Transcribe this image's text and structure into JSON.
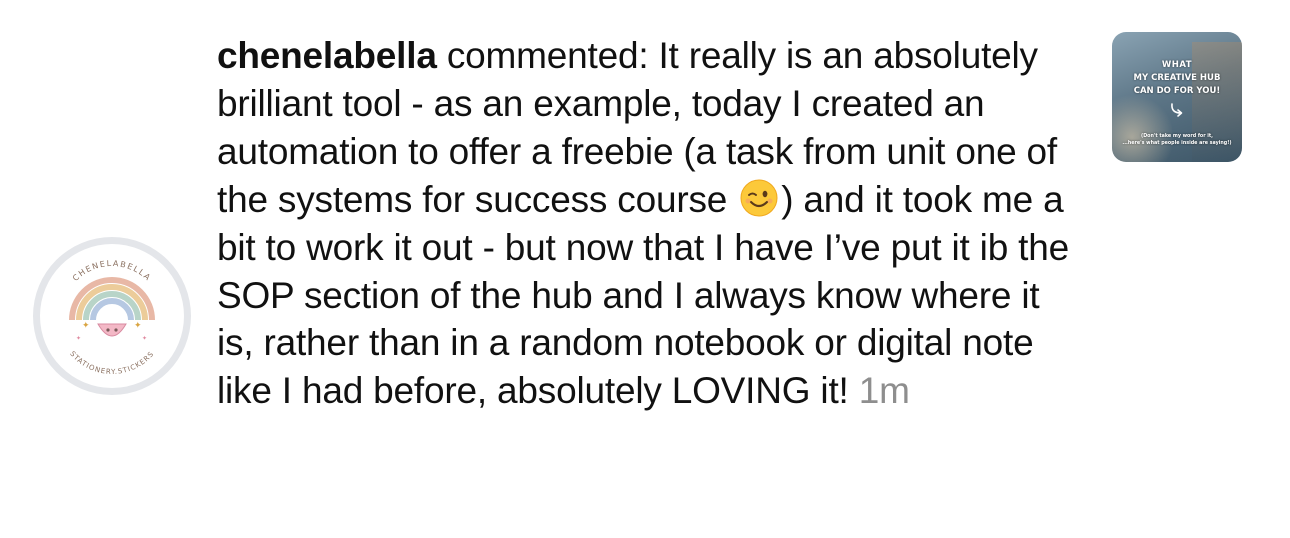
{
  "comment": {
    "username": "chenelabella",
    "text": "commented: It really is an absolutely brilliant tool - as an example, today I created an automation to offer a freebie (a task from unit one of the systems for success course",
    "emoji_icon": "winking-face-icon",
    "text_after_emoji": ") and it took me a bit to work it out - but now that I have I’ve put it ib the SOP section of the hub and I always know where it is, rather than in a random notebook or digital note like I had before, absolutely LOVING it!",
    "timestamp": "1m"
  },
  "avatar": {
    "ring_text_top": "CHENELABELLA",
    "ring_text_bottom": "STATIONERY.STICKERS"
  },
  "thumbnail": {
    "line1": "WHAT",
    "line2": "MY CREATIVE HUB",
    "line3": "CAN DO FOR YOU!",
    "arrow_icon": "curved-arrow-icon",
    "small_line1": "(Don't take my word for it,",
    "small_line2": "...here's what people inside are saying!)"
  },
  "colors": {
    "text": "#111111",
    "timestamp": "#8e8e8e",
    "avatar_ring": "#e4e6ea"
  }
}
